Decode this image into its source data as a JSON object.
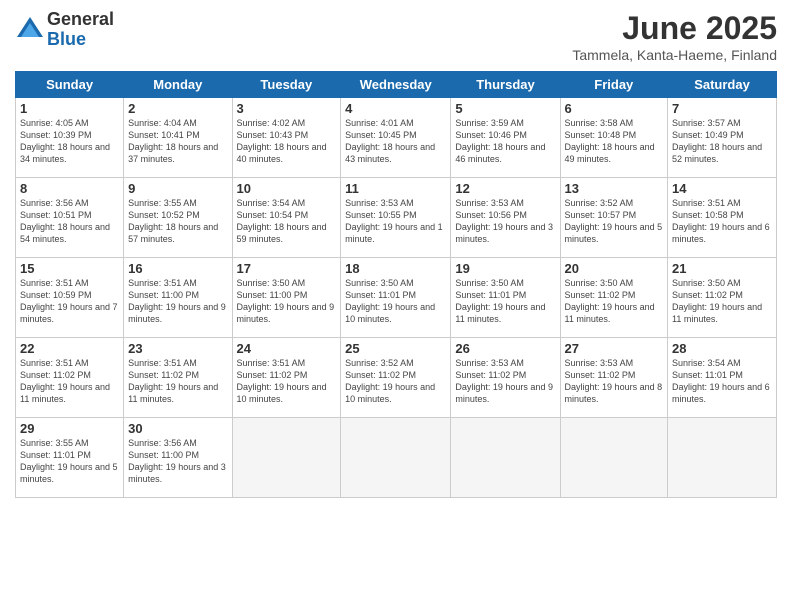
{
  "logo": {
    "general": "General",
    "blue": "Blue"
  },
  "title": "June 2025",
  "subtitle": "Tammela, Kanta-Haeme, Finland",
  "days_header": [
    "Sunday",
    "Monday",
    "Tuesday",
    "Wednesday",
    "Thursday",
    "Friday",
    "Saturday"
  ],
  "weeks": [
    [
      {
        "day": "1",
        "sunrise": "4:05 AM",
        "sunset": "10:39 PM",
        "daylight": "18 hours and 34 minutes."
      },
      {
        "day": "2",
        "sunrise": "4:04 AM",
        "sunset": "10:41 PM",
        "daylight": "18 hours and 37 minutes."
      },
      {
        "day": "3",
        "sunrise": "4:02 AM",
        "sunset": "10:43 PM",
        "daylight": "18 hours and 40 minutes."
      },
      {
        "day": "4",
        "sunrise": "4:01 AM",
        "sunset": "10:45 PM",
        "daylight": "18 hours and 43 minutes."
      },
      {
        "day": "5",
        "sunrise": "3:59 AM",
        "sunset": "10:46 PM",
        "daylight": "18 hours and 46 minutes."
      },
      {
        "day": "6",
        "sunrise": "3:58 AM",
        "sunset": "10:48 PM",
        "daylight": "18 hours and 49 minutes."
      },
      {
        "day": "7",
        "sunrise": "3:57 AM",
        "sunset": "10:49 PM",
        "daylight": "18 hours and 52 minutes."
      }
    ],
    [
      {
        "day": "8",
        "sunrise": "3:56 AM",
        "sunset": "10:51 PM",
        "daylight": "18 hours and 54 minutes."
      },
      {
        "day": "9",
        "sunrise": "3:55 AM",
        "sunset": "10:52 PM",
        "daylight": "18 hours and 57 minutes."
      },
      {
        "day": "10",
        "sunrise": "3:54 AM",
        "sunset": "10:54 PM",
        "daylight": "18 hours and 59 minutes."
      },
      {
        "day": "11",
        "sunrise": "3:53 AM",
        "sunset": "10:55 PM",
        "daylight": "19 hours and 1 minute."
      },
      {
        "day": "12",
        "sunrise": "3:53 AM",
        "sunset": "10:56 PM",
        "daylight": "19 hours and 3 minutes."
      },
      {
        "day": "13",
        "sunrise": "3:52 AM",
        "sunset": "10:57 PM",
        "daylight": "19 hours and 5 minutes."
      },
      {
        "day": "14",
        "sunrise": "3:51 AM",
        "sunset": "10:58 PM",
        "daylight": "19 hours and 6 minutes."
      }
    ],
    [
      {
        "day": "15",
        "sunrise": "3:51 AM",
        "sunset": "10:59 PM",
        "daylight": "19 hours and 7 minutes."
      },
      {
        "day": "16",
        "sunrise": "3:51 AM",
        "sunset": "11:00 PM",
        "daylight": "19 hours and 9 minutes."
      },
      {
        "day": "17",
        "sunrise": "3:50 AM",
        "sunset": "11:00 PM",
        "daylight": "19 hours and 9 minutes."
      },
      {
        "day": "18",
        "sunrise": "3:50 AM",
        "sunset": "11:01 PM",
        "daylight": "19 hours and 10 minutes."
      },
      {
        "day": "19",
        "sunrise": "3:50 AM",
        "sunset": "11:01 PM",
        "daylight": "19 hours and 11 minutes."
      },
      {
        "day": "20",
        "sunrise": "3:50 AM",
        "sunset": "11:02 PM",
        "daylight": "19 hours and 11 minutes."
      },
      {
        "day": "21",
        "sunrise": "3:50 AM",
        "sunset": "11:02 PM",
        "daylight": "19 hours and 11 minutes."
      }
    ],
    [
      {
        "day": "22",
        "sunrise": "3:51 AM",
        "sunset": "11:02 PM",
        "daylight": "19 hours and 11 minutes."
      },
      {
        "day": "23",
        "sunrise": "3:51 AM",
        "sunset": "11:02 PM",
        "daylight": "19 hours and 11 minutes."
      },
      {
        "day": "24",
        "sunrise": "3:51 AM",
        "sunset": "11:02 PM",
        "daylight": "19 hours and 10 minutes."
      },
      {
        "day": "25",
        "sunrise": "3:52 AM",
        "sunset": "11:02 PM",
        "daylight": "19 hours and 10 minutes."
      },
      {
        "day": "26",
        "sunrise": "3:53 AM",
        "sunset": "11:02 PM",
        "daylight": "19 hours and 9 minutes."
      },
      {
        "day": "27",
        "sunrise": "3:53 AM",
        "sunset": "11:02 PM",
        "daylight": "19 hours and 8 minutes."
      },
      {
        "day": "28",
        "sunrise": "3:54 AM",
        "sunset": "11:01 PM",
        "daylight": "19 hours and 6 minutes."
      }
    ],
    [
      {
        "day": "29",
        "sunrise": "3:55 AM",
        "sunset": "11:01 PM",
        "daylight": "19 hours and 5 minutes."
      },
      {
        "day": "30",
        "sunrise": "3:56 AM",
        "sunset": "11:00 PM",
        "daylight": "19 hours and 3 minutes."
      },
      null,
      null,
      null,
      null,
      null
    ]
  ]
}
